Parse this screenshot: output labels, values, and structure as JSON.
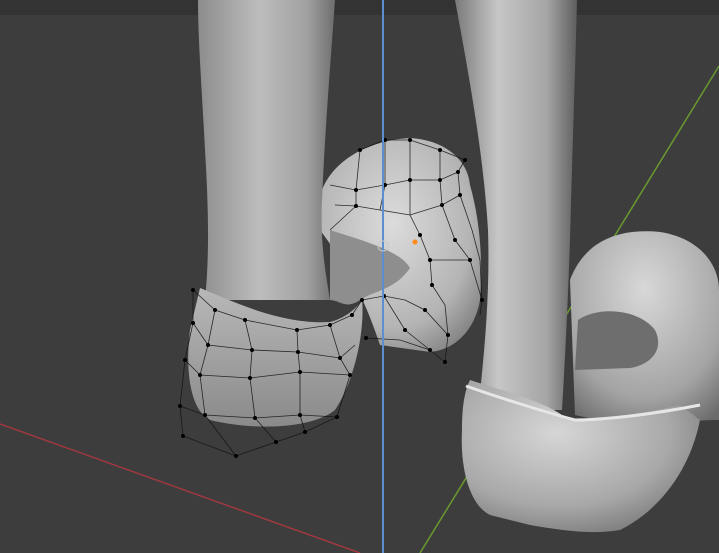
{
  "viewport": {
    "background": "#3d3d3d",
    "header_strip": "#333333",
    "axis_x_color": "#a0393f",
    "axis_y_color": "#6a9a2d",
    "axis_z_color": "#5b8fd0",
    "mesh_color": "#9a9a9a",
    "wire_color": "#111111",
    "selected_vertex_color": "#ff8a1a"
  },
  "overlays": {
    "origin_marker": "object-origin",
    "gizmo_visible": true
  }
}
